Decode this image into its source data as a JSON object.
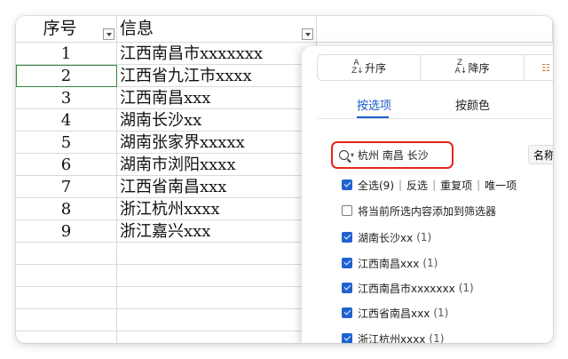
{
  "table": {
    "headers": [
      "序号",
      "信息"
    ],
    "rows": [
      {
        "no": "1",
        "info": "江西南昌市xxxxxxx"
      },
      {
        "no": "2",
        "info": "江西省九江市xxxx"
      },
      {
        "no": "3",
        "info": "江西南昌xxx"
      },
      {
        "no": "4",
        "info": "湖南长沙xx"
      },
      {
        "no": "5",
        "info": "湖南张家界xxxxx"
      },
      {
        "no": "6",
        "info": "湖南市浏阳xxxx"
      },
      {
        "no": "7",
        "info": "江西省南昌xxx"
      },
      {
        "no": "8",
        "info": "浙江杭州xxxx"
      },
      {
        "no": "9",
        "info": "浙江嘉兴xxx"
      }
    ]
  },
  "filter_panel": {
    "sort_asc": "升序",
    "sort_desc": "降序",
    "tab_by_option": "按选项",
    "tab_by_color": "按颜色",
    "search_value": "杭州 南昌 长沙",
    "sort_by_name": "名称 ↑",
    "select_all": "全选(9)",
    "invert": "反选",
    "duplicates": "重复项",
    "unique": "唯一项",
    "add_to_filter": "将当前所选内容添加到筛选器",
    "items": [
      {
        "label": "湖南长沙xx",
        "count": "(1)"
      },
      {
        "label": "江西南昌xxx",
        "count": "(1)"
      },
      {
        "label": "江西南昌市xxxxxxx",
        "count": "(1)"
      },
      {
        "label": "江西省南昌xxx",
        "count": "(1)"
      },
      {
        "label": "浙江杭州xxxx",
        "count": "(1)"
      }
    ]
  },
  "colors": {
    "accent": "#1a5dc8",
    "highlight": "#e3261f",
    "selection": "#2f8b3f"
  }
}
